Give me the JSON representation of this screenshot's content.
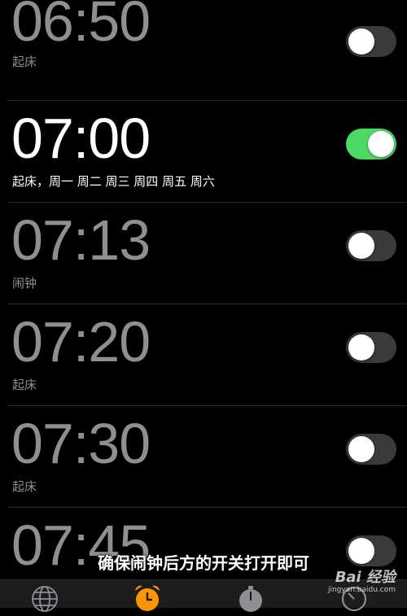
{
  "alarms": [
    {
      "time": "06:50",
      "label": "起床",
      "enabled": false
    },
    {
      "time": "07:00",
      "label": "起床，周一 周二 周三 周四 周五 周六",
      "enabled": true
    },
    {
      "time": "07:13",
      "label": "闹钟",
      "enabled": false
    },
    {
      "time": "07:20",
      "label": "起床",
      "enabled": false
    },
    {
      "time": "07:30",
      "label": "起床",
      "enabled": false
    },
    {
      "time": "07:45",
      "label": "",
      "enabled": false
    }
  ],
  "caption": "确保闹钟后方的开关打开即可",
  "watermark": {
    "brand": "Bai 经验",
    "url": "jingyan.baidu.com"
  },
  "tabbar": {
    "tabs": [
      {
        "icon": "globe-icon"
      },
      {
        "icon": "alarm-clock-icon",
        "active": true
      },
      {
        "icon": "stopwatch-icon"
      },
      {
        "icon": "timer-icon"
      }
    ]
  },
  "colors": {
    "toggle_on": "#4cd964",
    "toggle_off": "#3a3a3c",
    "active_tab": "#ff9500",
    "text_dim": "#8e8e93"
  }
}
